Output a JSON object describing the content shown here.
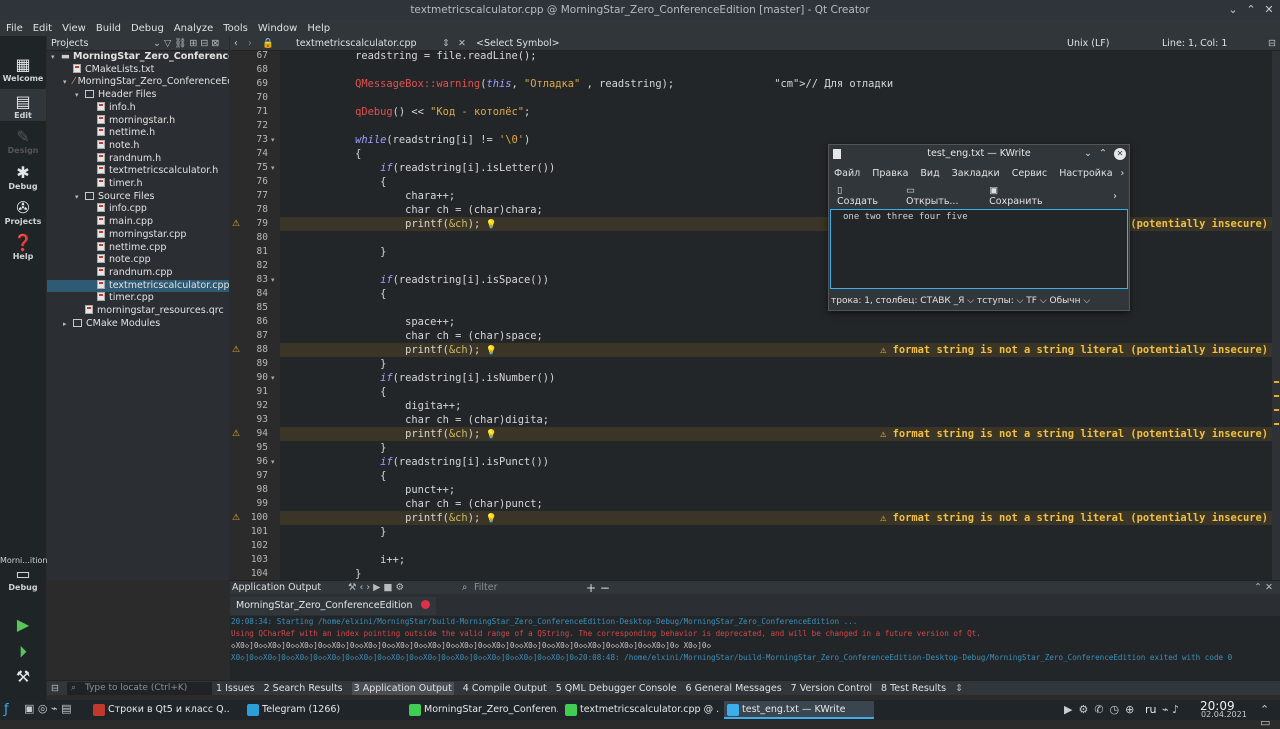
{
  "window_title": "textmetricscalculator.cpp @ MorningStar_Zero_ConferenceEdition [master] - Qt Creator",
  "menu": [
    "File",
    "Edit",
    "View",
    "Build",
    "Debug",
    "Analyze",
    "Tools",
    "Window",
    "Help"
  ],
  "modes": [
    {
      "label": "Welcome",
      "icon": "grid-icon"
    },
    {
      "label": "Edit",
      "icon": "edit-icon"
    },
    {
      "label": "Design",
      "icon": "design-icon"
    },
    {
      "label": "Debug",
      "icon": "bug-icon"
    },
    {
      "label": "Projects",
      "icon": "wrench-icon"
    },
    {
      "label": "Help",
      "icon": "help-icon"
    }
  ],
  "kit": {
    "label": "Morni...ition",
    "mode": "Debug"
  },
  "projects": {
    "header": "Projects",
    "tree": [
      {
        "label": "MorningStar_Zero_ConferenceE",
        "level": 0,
        "type": "project",
        "bold": true
      },
      {
        "label": "CMakeLists.txt",
        "level": 1,
        "type": "file"
      },
      {
        "label": "MorningStar_Zero_ConferenceEd",
        "level": 1,
        "type": "target"
      },
      {
        "label": "Header Files",
        "level": 2,
        "type": "folder"
      },
      {
        "label": "info.h",
        "level": 3,
        "type": "file"
      },
      {
        "label": "morningstar.h",
        "level": 3,
        "type": "file"
      },
      {
        "label": "nettime.h",
        "level": 3,
        "type": "file"
      },
      {
        "label": "note.h",
        "level": 3,
        "type": "file"
      },
      {
        "label": "randnum.h",
        "level": 3,
        "type": "file"
      },
      {
        "label": "textmetricscalculator.h",
        "level": 3,
        "type": "file"
      },
      {
        "label": "timer.h",
        "level": 3,
        "type": "file"
      },
      {
        "label": "Source Files",
        "level": 2,
        "type": "folder"
      },
      {
        "label": "info.cpp",
        "level": 3,
        "type": "file"
      },
      {
        "label": "main.cpp",
        "level": 3,
        "type": "file"
      },
      {
        "label": "morningstar.cpp",
        "level": 3,
        "type": "file"
      },
      {
        "label": "nettime.cpp",
        "level": 3,
        "type": "file"
      },
      {
        "label": "note.cpp",
        "level": 3,
        "type": "file"
      },
      {
        "label": "randnum.cpp",
        "level": 3,
        "type": "file"
      },
      {
        "label": "textmetricscalculator.cpp",
        "level": 3,
        "type": "file",
        "selected": true
      },
      {
        "label": "timer.cpp",
        "level": 3,
        "type": "file"
      },
      {
        "label": "morningstar_resources.qrc",
        "level": 2,
        "type": "file"
      },
      {
        "label": "CMake Modules",
        "level": 1,
        "type": "folder"
      }
    ]
  },
  "editor": {
    "file_tab": "textmetricscalculator.cpp",
    "symbol": "<Select Symbol>",
    "line_ending": "Unix (LF)",
    "position": "Line: 1, Col: 1",
    "warning": "format string is not a string literal (potentially insecure)",
    "lines": [
      {
        "n": "67",
        "code": "            readstring = file.readLine();"
      },
      {
        "n": "68",
        "code": ""
      },
      {
        "n": "69",
        "code": "            QMessageBox::warning(this, \"Отладка\" , readstring);                // Для отладки"
      },
      {
        "n": "70",
        "code": ""
      },
      {
        "n": "71",
        "code": "            qDebug() << \"Код - котолёс\";"
      },
      {
        "n": "72",
        "code": ""
      },
      {
        "n": "73",
        "code": "            while(readstring[i] != '\\0')",
        "fold": true
      },
      {
        "n": "74",
        "code": "            {"
      },
      {
        "n": "75",
        "code": "                if(readstring[i].isLetter())",
        "fold": true
      },
      {
        "n": "76",
        "code": "                {"
      },
      {
        "n": "77",
        "code": "                    chara++;"
      },
      {
        "n": "78",
        "code": "                    char ch = (char)chara;"
      },
      {
        "n": "79",
        "code": "                    printf(&ch);",
        "warn": true,
        "msg": "(potentially insecure)"
      },
      {
        "n": "80",
        "code": ""
      },
      {
        "n": "81",
        "code": "                }"
      },
      {
        "n": "82",
        "code": ""
      },
      {
        "n": "83",
        "code": "                if(readstring[i].isSpace())",
        "fold": true
      },
      {
        "n": "84",
        "code": "                {"
      },
      {
        "n": "85",
        "code": ""
      },
      {
        "n": "86",
        "code": "                    space++;"
      },
      {
        "n": "87",
        "code": "                    char ch = (char)space;"
      },
      {
        "n": "88",
        "code": "                    printf(&ch);",
        "warn": true,
        "msg": "⚠ format string is not a string literal (potentially insecure)"
      },
      {
        "n": "89",
        "code": "                }"
      },
      {
        "n": "90",
        "code": "                if(readstring[i].isNumber())",
        "fold": true
      },
      {
        "n": "91",
        "code": "                {"
      },
      {
        "n": "92",
        "code": "                    digita++;"
      },
      {
        "n": "93",
        "code": "                    char ch = (char)digita;"
      },
      {
        "n": "94",
        "code": "                    printf(&ch);",
        "warn": true,
        "msg": "⚠ format string is not a string literal (potentially insecure)"
      },
      {
        "n": "95",
        "code": "                }"
      },
      {
        "n": "96",
        "code": "                if(readstring[i].isPunct())",
        "fold": true
      },
      {
        "n": "97",
        "code": "                {"
      },
      {
        "n": "98",
        "code": "                    punct++;"
      },
      {
        "n": "99",
        "code": "                    char ch = (char)punct;"
      },
      {
        "n": "100",
        "code": "                    printf(&ch);",
        "warn": true,
        "msg": "⚠ format string is not a string literal (potentially insecure)"
      },
      {
        "n": "101",
        "code": "                }"
      },
      {
        "n": "102",
        "code": ""
      },
      {
        "n": "103",
        "code": "                i++;"
      },
      {
        "n": "104",
        "code": "            }"
      }
    ]
  },
  "output": {
    "header": "Application Output",
    "filter_placeholder": "Filter",
    "tab": "MorningStar_Zero_ConferenceEdition",
    "lines": [
      {
        "text": "20:08:34: Starting /home/elxini/MorningStar/build-MorningStar_Zero_ConferenceEdition-Desktop-Debug/MorningStar_Zero_ConferenceEdition ...",
        "color": "#3d8fb8"
      },
      {
        "text": "Using QCharRef with an index pointing outside the valid range of a QString. The corresponding behavior is deprecated, and will be changed in a future version of Qt.",
        "color": "#d04848"
      },
      {
        "text": "◇X0◇]0◇◇X0◇]0◇◇X0◇]0◇◇X0◇]0◇◇X0◇]0◇◇X0◇]0◇◇X0◇]0◇◇X0◇]0◇◇X0◇]0◇◇X0◇]0◇◇X0◇]0◇◇X0◇]0◇◇X0◇]0◇◇X0◇]0◇   X0◇]0◇",
        "color": "#c8c8c8"
      },
      {
        "text": "X0◇]0◇◇X0◇]0◇◇X0◇]0◇◇X0◇]0◇◇X0◇]0◇◇X0◇]0◇◇X0◇]0◇◇X0◇]0◇◇X0◇]0◇◇X0◇]0◇◇X0◇]0◇20:08:48: /home/elxini/MorningStar/build-MorningStar_Zero_ConferenceEdition-Desktop-Debug/MorningStar_Zero_ConferenceEdition exited with code 0",
        "color": "#3d8fb8"
      }
    ]
  },
  "statusbar": {
    "locate_placeholder": "Type to locate (Ctrl+K)",
    "panes": [
      "1 Issues",
      "2 Search Results",
      "3 Application Output",
      "4 Compile Output",
      "5 QML Debugger Console",
      "6 General Messages",
      "7 Version Control",
      "8 Test Results"
    ]
  },
  "kwrite": {
    "title": "test_eng.txt — KWrite",
    "menu": [
      "Файл",
      "Правка",
      "Вид",
      "Закладки",
      "Сервис",
      "Настройка"
    ],
    "toolbar": [
      "Создать",
      "Открыть...",
      "Сохранить"
    ],
    "content": "one two three four five",
    "status": "трока: 1, столбец:  СТАВК   _Я ⌵    тступы: ⌵   TF ⌵   Обычн ⌵"
  },
  "taskbar": {
    "tasks": [
      {
        "label": "Строки в Qt5 и класс Q...",
        "color": "#c0392b"
      },
      {
        "label": "Telegram (1266)",
        "color": "#2a9fd8"
      },
      {
        "label": "MorningStar_Zero_Conferen...",
        "color": "#41cd52"
      },
      {
        "label": "textmetricscalculator.cpp @ ...",
        "color": "#41cd52"
      },
      {
        "label": "test_eng.txt  — KWrite",
        "color": "#3daee9",
        "active": true
      }
    ],
    "lang": "ru",
    "time": "20:09",
    "date": "02.04.2021"
  }
}
